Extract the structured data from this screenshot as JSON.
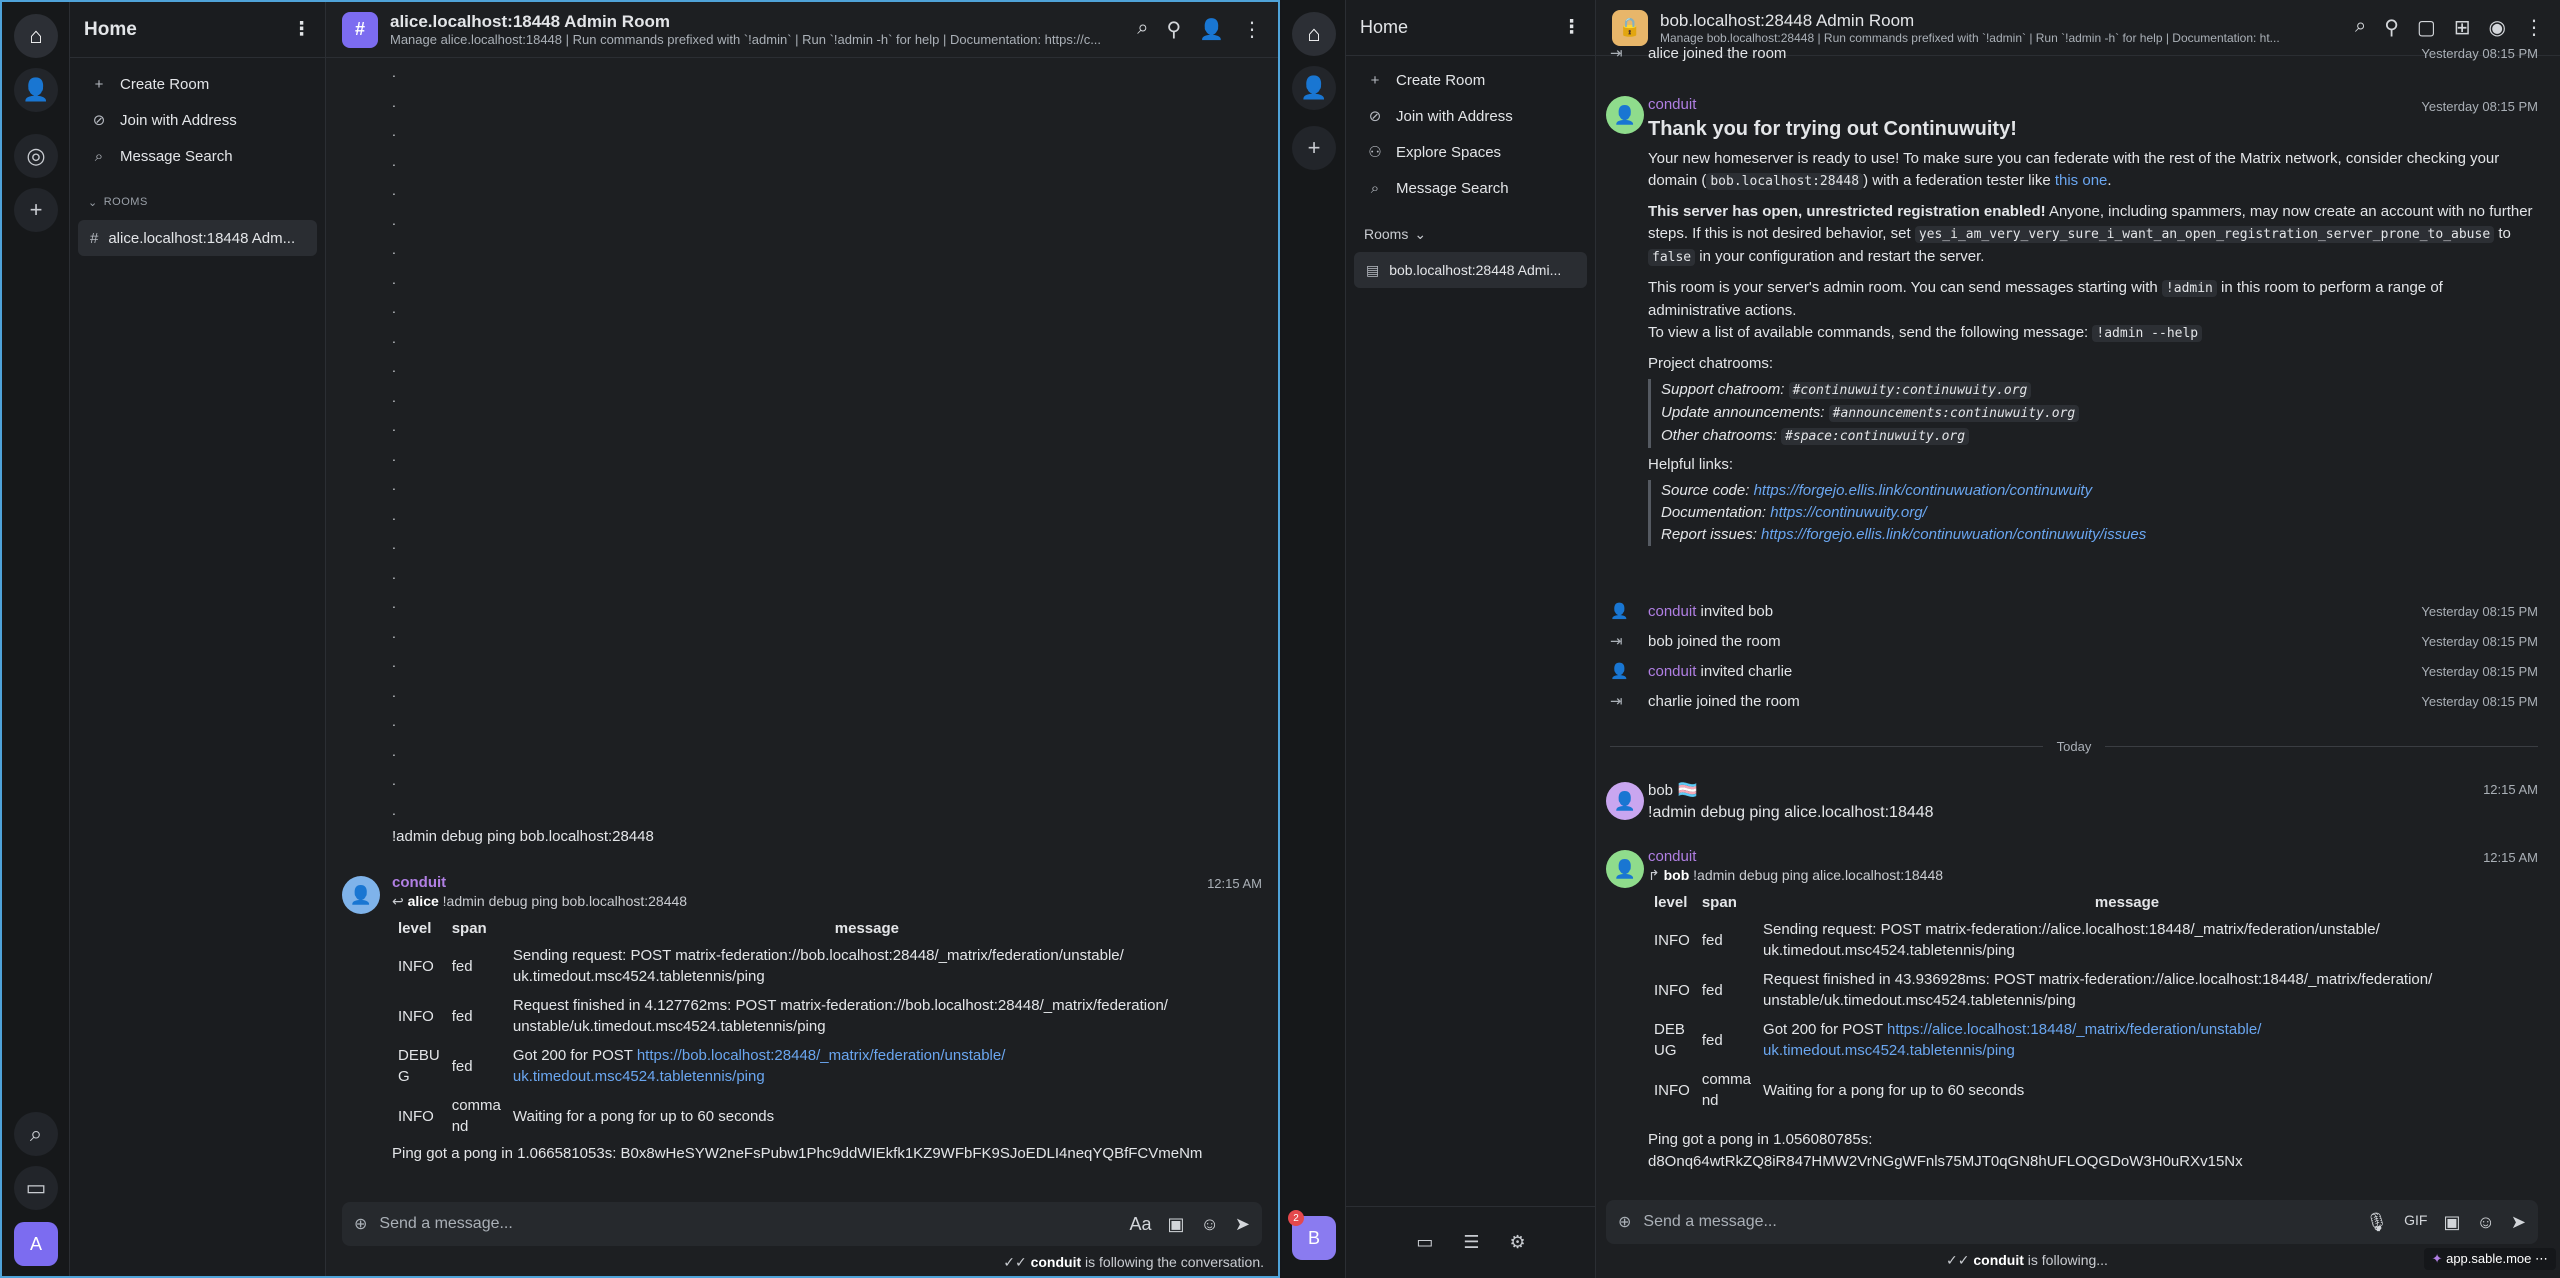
{
  "left": {
    "sidebar": {
      "title": "Home",
      "items": [
        {
          "label": "Create Room",
          "icon": "plus-icon"
        },
        {
          "label": "Join with Address",
          "icon": "link-icon"
        },
        {
          "label": "Message Search",
          "icon": "search-icon"
        }
      ],
      "rooms_section": "ROOMS",
      "room": "alice.localhost:18448 Adm..."
    },
    "header": {
      "title": "alice.localhost:18448 Admin Room",
      "topic": "Manage alice.localhost:18448 | Run commands prefixed with `!admin` | Run `!admin -h` for help | Documentation: https://c..."
    },
    "dots": [
      ".",
      ".",
      ".",
      ".",
      ".",
      ".",
      ".",
      ".",
      ".",
      ".",
      ".",
      ".",
      ".",
      ".",
      ".",
      ".",
      ".",
      ".",
      ".",
      ".",
      ".",
      ".",
      ".",
      ".",
      ".",
      "."
    ],
    "command": "!admin debug ping bob.localhost:28448",
    "reply_msg": {
      "sender": "conduit",
      "time": "12:15 AM",
      "reply_to_user": "alice",
      "reply_to_text": "!admin debug ping bob.localhost:28448",
      "columns": [
        "level",
        "span",
        "message"
      ],
      "rows": [
        {
          "level": "INFO",
          "span": "fed",
          "message": "Sending request: POST matrix-federation://bob.localhost:28448/_matrix/federation/unstable/ uk.timedout.msc4524.tabletennis/ping"
        },
        {
          "level": "INFO",
          "span": "fed",
          "message": "Request finished in 4.127762ms: POST matrix-federation://bob.localhost:28448/_matrix/federation/ unstable/uk.timedout.msc4524.tabletennis/ping"
        },
        {
          "level": "DEBU G",
          "span": "fed",
          "message_prefix": "Got 200 for POST ",
          "message_link": "https://bob.localhost:28448/_matrix/federation/unstable/ uk.timedout.msc4524.tabletennis/ping"
        },
        {
          "level": "INFO",
          "span": "comma nd",
          "message": "Waiting for a pong for up to 60 seconds"
        }
      ],
      "footer": "Ping got a pong in 1.066581053s: B0x8wHeSYW2neFsPubw1Phc9ddWIEkfk1KZ9WFbFK9SJoEDLI4neqYQBfFCVmeNm"
    },
    "composer": {
      "placeholder": "Send a message..."
    },
    "typing": {
      "user": "conduit",
      "text": " is following the conversation."
    },
    "rail": {
      "avatar": "A"
    }
  },
  "right": {
    "sidebar": {
      "title": "Home",
      "items": [
        {
          "label": "Create Room"
        },
        {
          "label": "Join with Address"
        },
        {
          "label": "Explore Spaces"
        },
        {
          "label": "Message Search"
        }
      ],
      "rooms_section": "Rooms",
      "room": "bob.localhost:28448 Admi...",
      "avatar": "B",
      "badge": "2"
    },
    "header": {
      "title": "bob.localhost:28448 Admin Room",
      "topic": "Manage bob.localhost:28448 | Run commands prefixed with `!admin` | Run `!admin -h` for help | Documentation: ht..."
    },
    "top_event": {
      "text": "alice joined the room",
      "time": "Yesterday 08:15 PM"
    },
    "welcome": {
      "sender": "conduit",
      "time": "Yesterday 08:15 PM",
      "heading": "Thank you for trying out Continuwuity!",
      "p1a": "Your new homeserver is ready to use! To make sure you can federate with the rest of the Matrix network, consider checking your domain (",
      "p1code": "bob.localhost:28448",
      "p1b": ") with a federation tester like ",
      "p1link": "this one",
      "p1c": ".",
      "p2bold": "This server has open, unrestricted registration enabled!",
      "p2a": " Anyone, including spammers, may now create an account with no further steps. If this is not desired behavior, set ",
      "p2code1": "yes_i_am_very_very_sure_i_want_an_open_registration_server_prone_to_abuse",
      "p2b": " to ",
      "p2code2": "false",
      "p2c": " in your configuration and restart the server.",
      "p3a": "This room is your server's admin room. You can send messages starting with ",
      "p3code": "!admin",
      "p3b": " in this room to perform a range of administrative actions.",
      "p4a": "To view a list of available commands, send the following message: ",
      "p4code": "!admin --help",
      "chatrooms_title": "Project chatrooms:",
      "chat1_label": "Support chatroom: ",
      "chat1_code": "#continuwuity:continuwuity.org",
      "chat2_label": "Update announcements: ",
      "chat2_code": "#announcements:continuwuity.org",
      "chat3_label": "Other chatrooms: ",
      "chat3_code": "#space:continuwuity.org",
      "links_title": "Helpful links:",
      "link1_label": "Source code: ",
      "link1": "https://forgejo.ellis.link/continuwuation/continuwuity",
      "link2_label": "Documentation: ",
      "link2": "https://continuwuity.org/",
      "link3_label": "Report issues: ",
      "link3": "https://forgejo.ellis.link/continuwuation/continuwuity/issues"
    },
    "events": [
      {
        "actor": "conduit",
        "text": "invited bob",
        "time": "Yesterday 08:15 PM",
        "kind": "invite"
      },
      {
        "actor": "bob",
        "text": "joined the room",
        "time": "Yesterday 08:15 PM",
        "kind": "join"
      },
      {
        "actor": "conduit",
        "text": "invited charlie",
        "time": "Yesterday 08:15 PM",
        "kind": "invite"
      },
      {
        "actor": "charlie",
        "text": "joined the room",
        "time": "Yesterday 08:15 PM",
        "kind": "join"
      }
    ],
    "divider": "Today",
    "bob_msg": {
      "sender": "bob",
      "flag": "🏳️‍⚧️",
      "time": "12:15 AM",
      "text": "!admin debug ping alice.localhost:18448"
    },
    "reply_msg": {
      "sender": "conduit",
      "time": "12:15 AM",
      "reply_to_user": "bob",
      "reply_to_text": "!admin debug ping alice.localhost:18448",
      "columns": [
        "level",
        "span",
        "message"
      ],
      "rows": [
        {
          "level": "INFO",
          "span": "fed",
          "message": "Sending request: POST matrix-federation://alice.localhost:18448/_matrix/federation/unstable/ uk.timedout.msc4524.tabletennis/ping"
        },
        {
          "level": "INFO",
          "span": "fed",
          "message": "Request finished in 43.936928ms: POST matrix-federation://alice.localhost:18448/_matrix/federation/ unstable/uk.timedout.msc4524.tabletennis/ping"
        },
        {
          "level": "DEB UG",
          "span": "fed",
          "message_prefix": "Got 200 for POST ",
          "message_link": "https://alice.localhost:18448/_matrix/federation/unstable/ uk.timedout.msc4524.tabletennis/ping"
        },
        {
          "level": "INFO",
          "span": "comma nd",
          "message": "Waiting for a pong for up to 60 seconds"
        }
      ],
      "footer1": "Ping got a pong in 1.056080785s:",
      "footer2": "d8Onq64wtRkZQ8iR847HMW2VrNGgWFnls75MJT0qGN8hUFLOQGDoW3H0uRXv15Nx"
    },
    "composer": {
      "placeholder": "Send a message...",
      "gif": "GIF"
    },
    "typing": {
      "user": "conduit",
      "text": " is following..."
    },
    "app_label": "app.sable.moe"
  }
}
